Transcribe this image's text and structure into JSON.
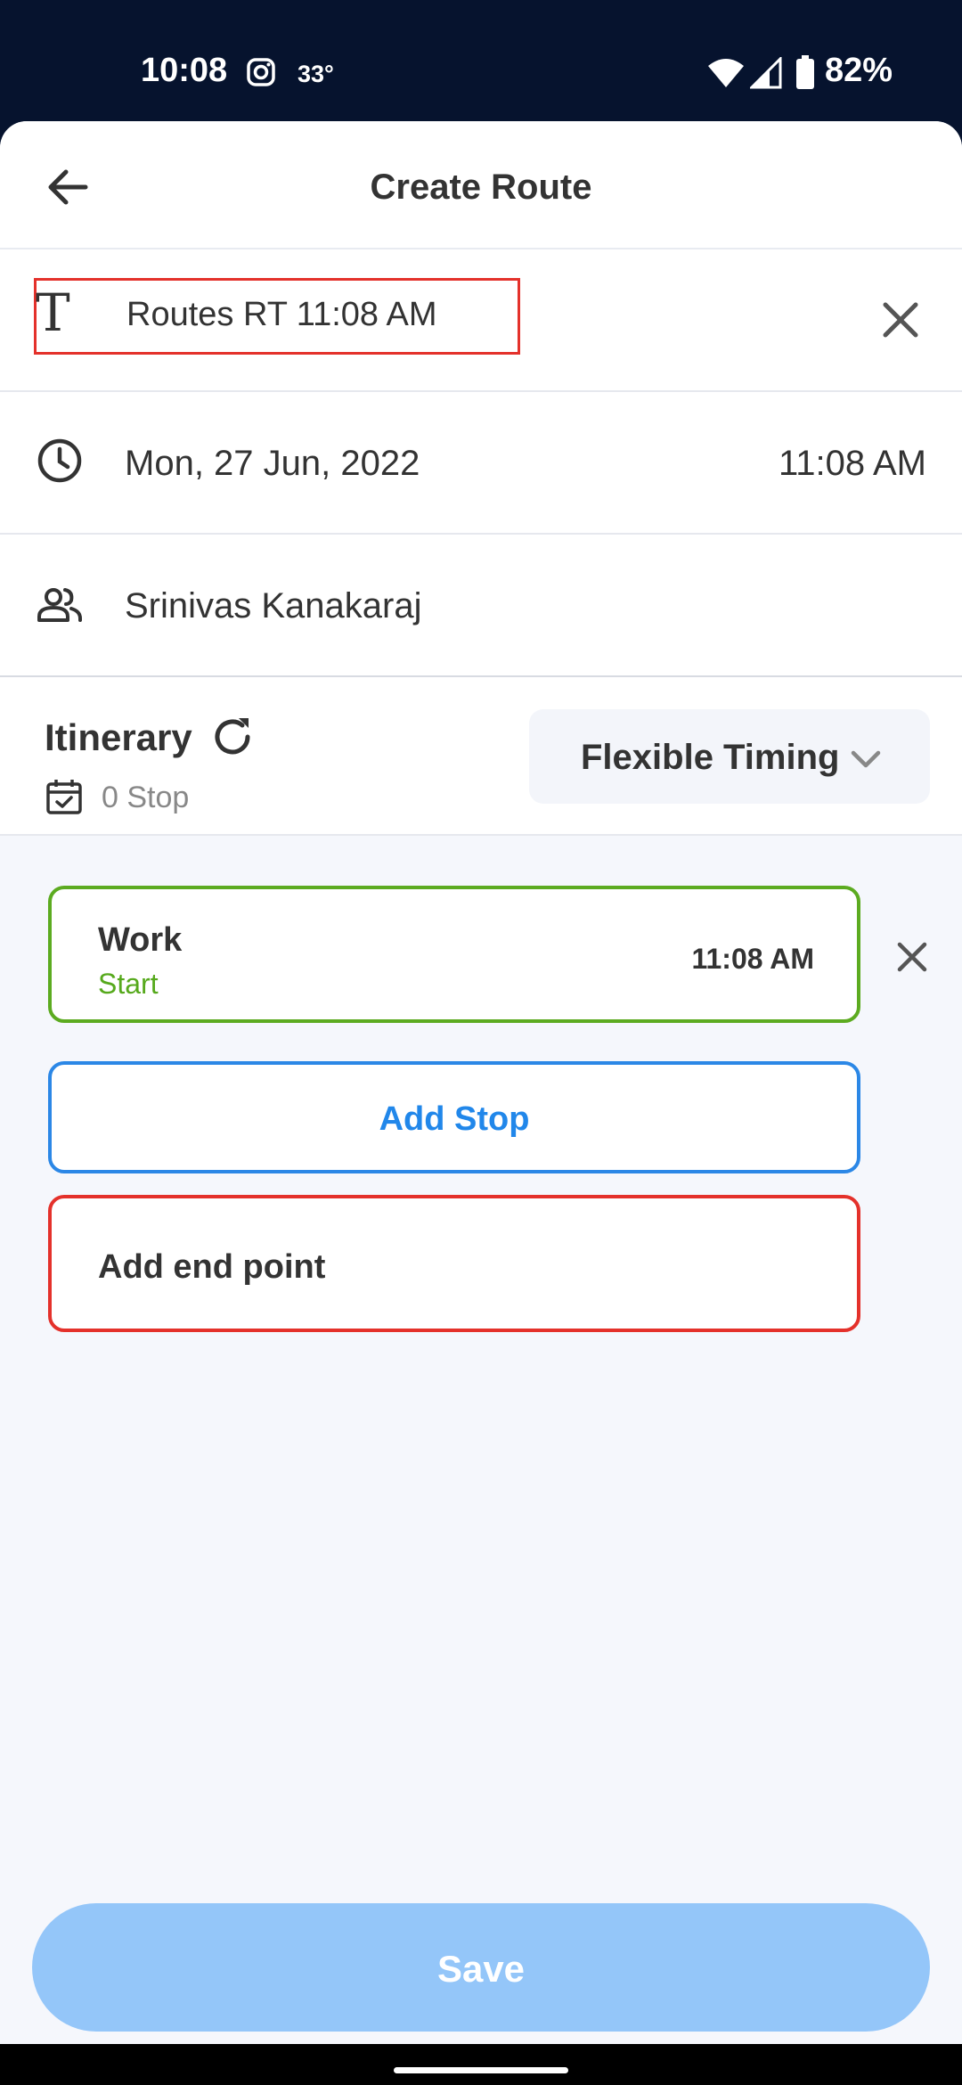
{
  "status_bar": {
    "time": "10:08",
    "temperature": "33°",
    "battery": "82%"
  },
  "header": {
    "title": "Create Route"
  },
  "route_name": {
    "value": "Routes RT 11:08 AM"
  },
  "schedule": {
    "date": "Mon, 27 Jun, 2022",
    "time": "11:08 AM"
  },
  "assignee": {
    "name": "Srinivas Kanakaraj"
  },
  "itinerary": {
    "title": "Itinerary",
    "stop_count": "0 Stop",
    "timing_mode": "Flexible Timing"
  },
  "start_point": {
    "name": "Work",
    "label": "Start",
    "time": "11:08 AM"
  },
  "actions": {
    "add_stop": "Add Stop",
    "add_end_point": "Add end point",
    "save": "Save"
  },
  "colors": {
    "start_border": "#5cab20",
    "add_stop_border": "#2b87e6",
    "end_border": "#e4312b",
    "save_disabled": "#94c6f9",
    "status_bar_bg": "#06132e"
  }
}
